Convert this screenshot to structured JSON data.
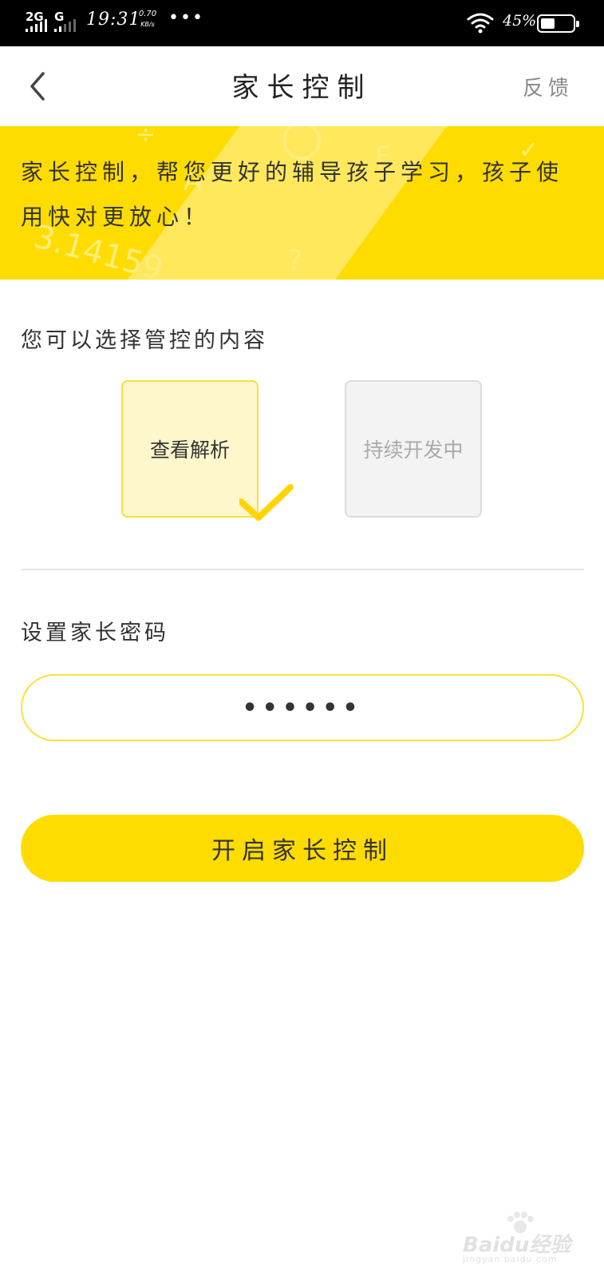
{
  "status_bar": {
    "network_1": "2G",
    "network_2": "G",
    "time": "19:31",
    "speed_value": "0.70",
    "speed_unit": "KB/s",
    "overflow": "•••",
    "battery_percent": "45%",
    "battery_level": 0.45,
    "icons": [
      "signal-icon",
      "wifi-icon",
      "battery-icon"
    ]
  },
  "nav": {
    "back_icon": "chevron-left-icon",
    "title": "家长控制",
    "feedback_label": "反馈"
  },
  "banner": {
    "text": "家长控制，帮您更好的辅导孩子学习，孩子使用快对更放心！",
    "background_color": "#ffdc00"
  },
  "controls": {
    "section_label": "您可以选择管控的内容",
    "options": [
      {
        "label": "查看解析",
        "selected": true
      },
      {
        "label": "持续开发中",
        "selected": false
      }
    ]
  },
  "password": {
    "section_label": "设置家长密码",
    "masked_value": "••••••"
  },
  "primary_button": {
    "label": "开启家长控制"
  },
  "watermark": {
    "text": "Baidu经验",
    "sub": "jingyan.baidu.com"
  },
  "colors": {
    "accent": "#ffdc00",
    "selected_bg": "#fff7cc",
    "disabled_bg": "#f3f3f3"
  }
}
